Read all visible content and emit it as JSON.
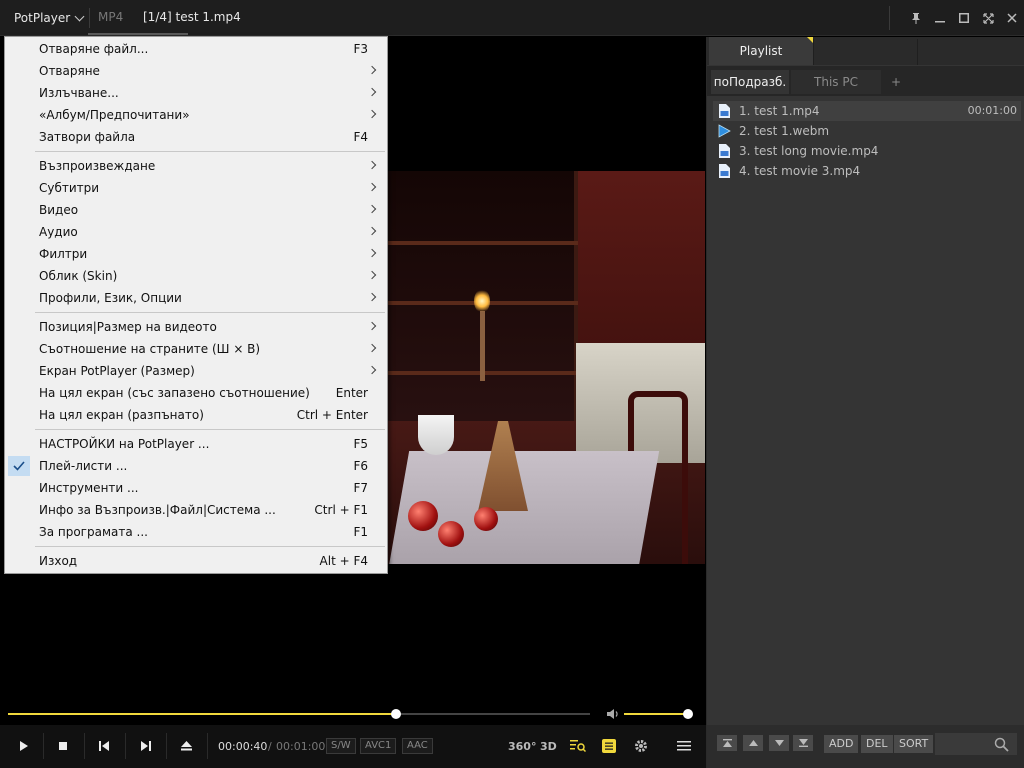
{
  "titlebar": {
    "app_name": "PotPlayer",
    "format": "MP4",
    "file_title": "[1/4] test 1.mp4"
  },
  "menu": {
    "groups": [
      [
        {
          "label": "Отваряне файл...",
          "shortcut": "F3",
          "submenu": false
        },
        {
          "label": "Отваряне",
          "shortcut": "",
          "submenu": true
        },
        {
          "label": "Излъчване...",
          "shortcut": "",
          "submenu": true
        },
        {
          "label": "«Албум/Предпочитани»",
          "shortcut": "",
          "submenu": true
        },
        {
          "label": "Затвори файла",
          "shortcut": "F4",
          "submenu": false
        }
      ],
      [
        {
          "label": "Възпроизвеждане",
          "shortcut": "",
          "submenu": true
        },
        {
          "label": "Субтитри",
          "shortcut": "",
          "submenu": true
        },
        {
          "label": "Видео",
          "shortcut": "",
          "submenu": true
        },
        {
          "label": "Аудио",
          "shortcut": "",
          "submenu": true
        },
        {
          "label": "Филтри",
          "shortcut": "",
          "submenu": true
        },
        {
          "label": "Облик (Skin)",
          "shortcut": "",
          "submenu": true
        },
        {
          "label": "Профили, Език, Опции",
          "shortcut": "",
          "submenu": true
        }
      ],
      [
        {
          "label": "Позиция|Размер на видеото",
          "shortcut": "",
          "submenu": true
        },
        {
          "label": "Съотношение на страните (Ш × В)",
          "shortcut": "",
          "submenu": true
        },
        {
          "label": "Екран PotPlayer (Размер)",
          "shortcut": "",
          "submenu": true
        },
        {
          "label": "На цял екран (със запазено съотношение)",
          "shortcut": "Enter",
          "submenu": false
        },
        {
          "label": "На цял екран (разпънато)",
          "shortcut": "Ctrl + Enter",
          "submenu": false
        }
      ],
      [
        {
          "label": "НАСТРОЙКИ на PotPlayer ...",
          "shortcut": "F5",
          "submenu": false
        },
        {
          "label": "Плей-листи ...",
          "shortcut": "F6",
          "submenu": false,
          "checked": true
        },
        {
          "label": "Инструменти ...",
          "shortcut": "F7",
          "submenu": false
        },
        {
          "label": "Инфо за Възпроизв.|Файл|Система ...",
          "shortcut": "Ctrl + F1",
          "submenu": false
        },
        {
          "label": "За програмата ...",
          "shortcut": "F1",
          "submenu": false
        }
      ],
      [
        {
          "label": "Изход",
          "shortcut": "Alt + F4",
          "submenu": false
        }
      ]
    ]
  },
  "playback": {
    "current_time": "00:00:40",
    "separator": "/",
    "total_time": "00:01:00",
    "progress": 0.6667,
    "volume": 1.0,
    "tags": [
      "S/W",
      "AVC1",
      "AAC"
    ],
    "label_360": "360°",
    "label_3d": "3D"
  },
  "playlist": {
    "main_tab": "Playlist",
    "subtabs": [
      "поПодразб.",
      "This PC",
      "+"
    ],
    "items": [
      {
        "label": "1. test 1.mp4",
        "duration": "00:01:00",
        "selected": true,
        "playing": false
      },
      {
        "label": "2. test 1.webm",
        "duration": "",
        "selected": false,
        "playing": true
      },
      {
        "label": "3. test long movie.mp4",
        "duration": "",
        "selected": false,
        "playing": false
      },
      {
        "label": "4. test movie 3.mp4",
        "duration": "",
        "selected": false,
        "playing": false
      }
    ],
    "buttons": [
      "ADD",
      "DEL",
      "SORT"
    ]
  },
  "colors": {
    "accent": "#f0d83c",
    "menu_bg": "#f0f0f0",
    "panel_bg": "#343434"
  }
}
